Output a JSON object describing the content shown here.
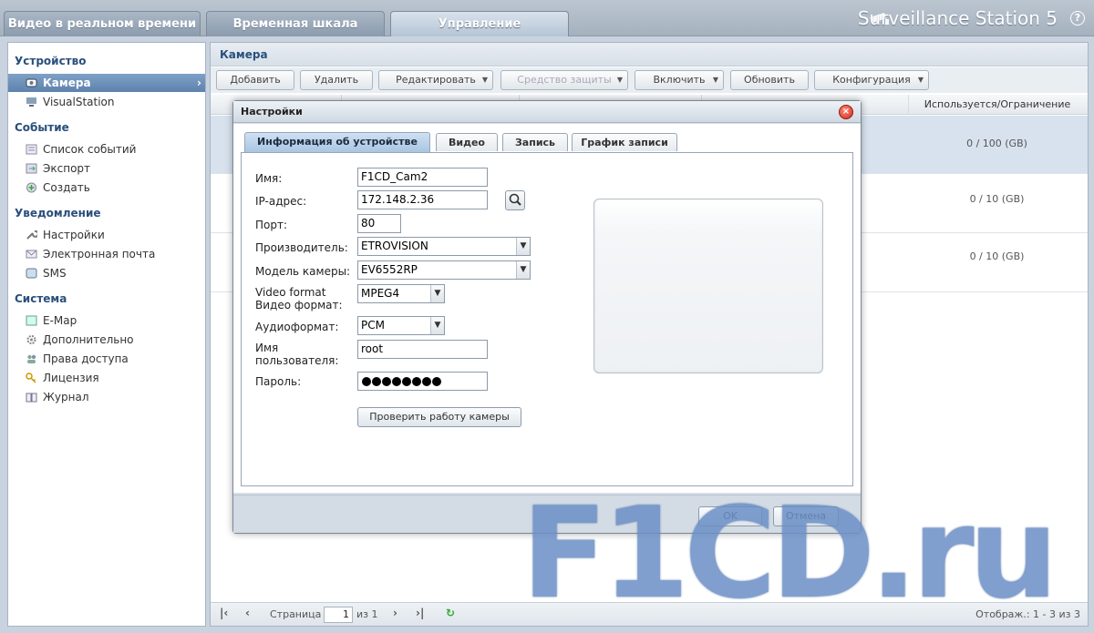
{
  "top_tabs": [
    {
      "label": "Видео в реальном времени"
    },
    {
      "label": "Временная шкала"
    },
    {
      "label": "Управление"
    }
  ],
  "brand": "Surveillance Station 5",
  "help_label": "?",
  "sidebar": {
    "sections": [
      {
        "title": "Устройство",
        "items": [
          {
            "label": "Камера",
            "icon": "camera-icon",
            "active": true
          },
          {
            "label": "VisualStation",
            "icon": "visualstation-icon"
          }
        ]
      },
      {
        "title": "Событие",
        "items": [
          {
            "label": "Список событий",
            "icon": "list-icon"
          },
          {
            "label": "Экспорт",
            "icon": "export-icon"
          },
          {
            "label": "Создать",
            "icon": "create-icon"
          }
        ]
      },
      {
        "title": "Уведомление",
        "items": [
          {
            "label": "Настройки",
            "icon": "wrench-icon"
          },
          {
            "label": "Электронная почта",
            "icon": "mail-icon"
          },
          {
            "label": "SMS",
            "icon": "sms-icon"
          }
        ]
      },
      {
        "title": "Система",
        "items": [
          {
            "label": "E-Map",
            "icon": "map-icon"
          },
          {
            "label": "Дополнительно",
            "icon": "gear-icon"
          },
          {
            "label": "Права доступа",
            "icon": "users-icon"
          },
          {
            "label": "Лицензия",
            "icon": "key-icon"
          },
          {
            "label": "Журнал",
            "icon": "book-icon"
          }
        ]
      }
    ]
  },
  "main": {
    "title": "Камера",
    "toolbar": [
      {
        "label": "Добавить"
      },
      {
        "label": "Удалить"
      },
      {
        "label": "Редактировать",
        "dropdown": true
      },
      {
        "label": "Средство защиты",
        "dropdown": true,
        "disabled": true
      },
      {
        "label": "Включить",
        "dropdown": true
      },
      {
        "label": "Обновить"
      },
      {
        "label": "Конфигурация",
        "dropdown": true
      }
    ],
    "columns": {
      "usage": "Используется/Ограничение"
    },
    "rows": [
      {
        "usage": "0 / 100 (GB)"
      },
      {
        "usage": "0 / 10 (GB)"
      },
      {
        "usage": "0 / 10 (GB)"
      }
    ],
    "pager": {
      "page_label": "Страница",
      "page_value": "1",
      "of_label": "из 1",
      "status": "Отображ.: 1 - 3 из 3"
    }
  },
  "dialog": {
    "title": "Настройки",
    "tabs": [
      {
        "label": "Информация об устройстве",
        "active": true
      },
      {
        "label": "Видео"
      },
      {
        "label": "Запись"
      },
      {
        "label": "График записи"
      }
    ],
    "fields": {
      "name_label": "Имя:",
      "name_value": "F1CD_Cam2",
      "ip_label": "IP-адрес:",
      "ip_value": "172.148.2.36",
      "port_label": "Порт:",
      "port_value": "80",
      "vendor_label": "Производитель:",
      "vendor_value": "ETROVISION",
      "model_label": "Модель камеры:",
      "model_value": "EV6552RP",
      "video_format_label_1": "Video format",
      "video_format_label_2": "Видео формат:",
      "video_format_value": "MPEG4",
      "audio_label": "Аудиоформат:",
      "audio_value": "PCM",
      "user_label_1": "Имя",
      "user_label_2": "пользователя:",
      "user_value": "root",
      "password_label": "Пароль:",
      "password_length": 8
    },
    "test_button": "Проверить работу камеры",
    "ok_button": "OK",
    "cancel_button": "Отмена"
  },
  "watermark": "F1CD.ru"
}
